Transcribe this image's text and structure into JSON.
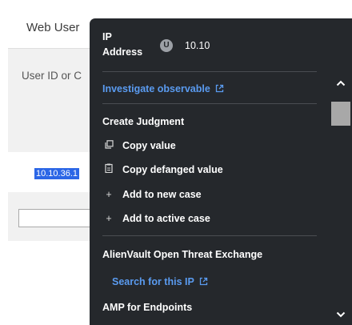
{
  "background": {
    "title": "Web User",
    "field_label": "User ID or C",
    "ip_value": "10.10.36.1"
  },
  "popover": {
    "header": {
      "label_line1": "IP",
      "label_line2": "Address",
      "badge": "U",
      "value": "10.10"
    },
    "investigate_link": "Investigate observable",
    "create_judgment": "Create Judgment",
    "actions": [
      {
        "label": "Copy value",
        "icon": "copy-icon"
      },
      {
        "label": "Copy defanged value",
        "icon": "clipboard-icon"
      },
      {
        "label": "Add to new case",
        "icon": "plus-icon"
      },
      {
        "label": "Add to active case",
        "icon": "plus-icon"
      }
    ],
    "sections": [
      {
        "title": "AlienVault Open Threat Exchange",
        "link": "Search for this IP"
      },
      {
        "title": "AMP for Endpoints"
      }
    ],
    "colors": {
      "background": "#25282c",
      "link": "#5a9bf0",
      "highlight": "#2b66e6"
    }
  }
}
